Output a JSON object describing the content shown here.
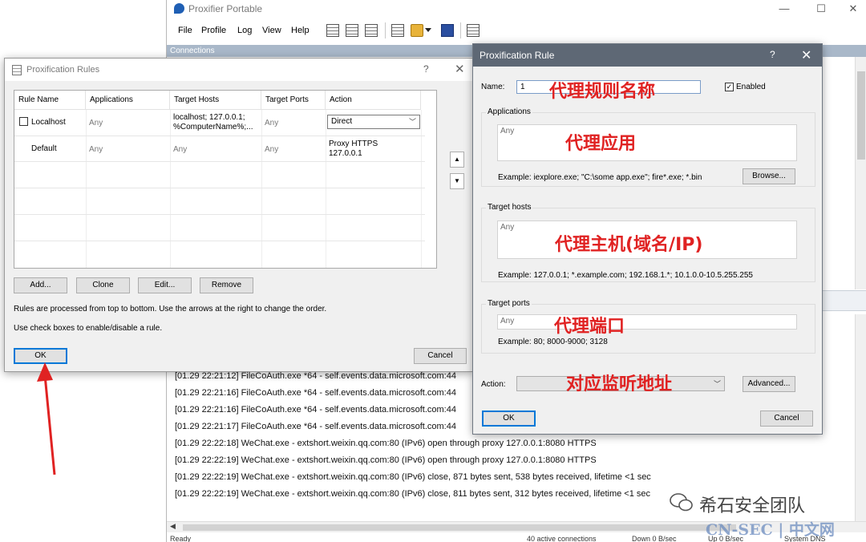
{
  "main_window": {
    "title": "Proxifier Portable",
    "menu": [
      "File",
      "Profile",
      "Log",
      "View",
      "Help"
    ],
    "connections_header": "Connections",
    "log_lines": [
      "[01.29 22:21:12] FileCoAuth.exe *64 - self.events.data.microsoft.com:44",
      "[01.29 22:21:16] FileCoAuth.exe *64 - self.events.data.microsoft.com:44",
      "[01.29 22:21:16] FileCoAuth.exe *64 - self.events.data.microsoft.com:44",
      "[01.29 22:21:17] FileCoAuth.exe *64 - self.events.data.microsoft.com:44",
      "[01.29 22:22:18] WeChat.exe - extshort.weixin.qq.com:80 (IPv6) open through proxy 127.0.0.1:8080 HTTPS",
      "[01.29 22:22:19] WeChat.exe - extshort.weixin.qq.com:80 (IPv6) open through proxy 127.0.0.1:8080 HTTPS",
      "[01.29 22:22:19] WeChat.exe - extshort.weixin.qq.com:80 (IPv6) close, 871 bytes sent, 538 bytes received, lifetime <1 sec",
      "[01.29 22:22:19] WeChat.exe - extshort.weixin.qq.com:80 (IPv6) close, 811 bytes sent, 312 bytes received, lifetime <1 sec"
    ],
    "status": {
      "ready": "Ready",
      "connections": "40 active connections",
      "down": "Down 0 B/sec",
      "up": "Up 0 B/sec",
      "dns": "System DNS"
    }
  },
  "rules_dialog": {
    "title": "Proxification Rules",
    "help": "?",
    "close": "✕",
    "columns": [
      "Rule Name",
      "Applications",
      "Target Hosts",
      "Target Ports",
      "Action"
    ],
    "rows": [
      {
        "name": "Localhost",
        "applications": "Any",
        "hosts_line1": "localhost; 127.0.0.1;",
        "hosts_line2": "%ComputerName%;...",
        "ports": "Any",
        "action": "Direct"
      },
      {
        "name": "Default",
        "applications": "Any",
        "hosts": "Any",
        "ports": "Any",
        "action_line1": "Proxy HTTPS",
        "action_line2": "127.0.0.1"
      }
    ],
    "buttons": {
      "add": "Add...",
      "clone": "Clone",
      "edit": "Edit...",
      "remove": "Remove",
      "ok": "OK",
      "cancel": "Cancel"
    },
    "note1": "Rules are processed from top to bottom. Use the arrows at the right to change the order.",
    "note2": "Use check boxes to enable/disable a rule."
  },
  "rule_dialog": {
    "title": "Proxification Rule",
    "help": "?",
    "close": "✕",
    "name_label": "Name:",
    "name_value": "1",
    "enabled_label": "Enabled",
    "applications": {
      "title": "Applications",
      "value": "Any",
      "example": "Example: iexplore.exe; \"C:\\some app.exe\"; fire*.exe; *.bin",
      "browse": "Browse..."
    },
    "target_hosts": {
      "title": "Target hosts",
      "value": "Any",
      "example": "Example: 127.0.0.1; *.example.com; 192.168.1.*; 10.1.0.0-10.5.255.255"
    },
    "target_ports": {
      "title": "Target ports",
      "value": "Any",
      "example": "Example: 80; 8000-9000; 3128"
    },
    "action_label": "Action:",
    "advanced": "Advanced...",
    "ok": "OK",
    "cancel": "Cancel"
  },
  "annotations": {
    "rule_name": "代理规则名称",
    "applications": "代理应用",
    "hosts": "代理主机(域名/IP)",
    "ports": "代理端口",
    "listen": "对应监听地址"
  },
  "watermark": {
    "account": "希石安全团队",
    "site": "CN-SEC | 中文网"
  },
  "colors": {
    "annotation_red": "#e02222",
    "rule_titlebar": "#5e6875",
    "focus_blue": "#0078d7"
  }
}
